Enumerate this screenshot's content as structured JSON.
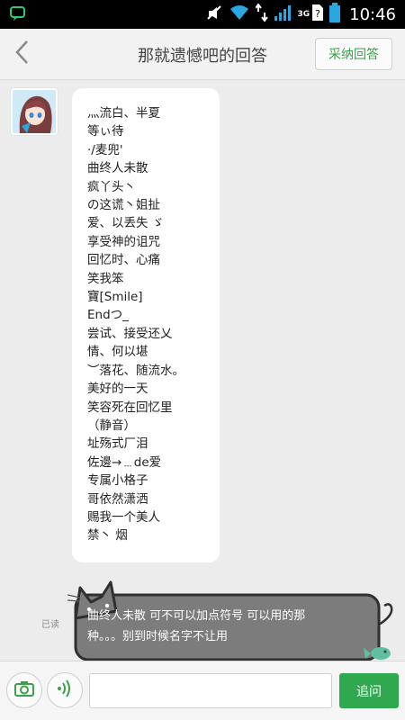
{
  "status_bar": {
    "time": "10:46",
    "network": "3G",
    "icons": [
      "chat-notification-icon",
      "mute-icon",
      "wifi-icon",
      "data-transfer-icon",
      "signal-icon",
      "battery-icon"
    ]
  },
  "navbar": {
    "title": "那就遗憾吧的回答",
    "accept_label": "采纳回答",
    "back_icon": "chevron-left-icon"
  },
  "message_left": {
    "lines": [
      "灬流白、半夏",
      "等ぃ待",
      "·/麦兜'",
      "曲终人未散",
      "疯丫头丶",
      "の这谎丶姐扯",
      "爱、以丢失 ゞ",
      "享受神的诅咒",
      "回忆时、心痛",
      "笑我笨",
      "寶[Smile]",
      "Endつ_",
      "尝试、接受还乂",
      "情、何以堪",
      "︶落花、随流水。",
      "美好的一天",
      "笑容死在回忆里",
      "（静音）",
      "址殇式厂泪",
      "佐邊→﹍de爱",
      "专属小格子",
      "哥依然潇洒",
      "赐我一个美人",
      "禁丶 烟"
    ]
  },
  "message_right": {
    "read_status": "已读",
    "line1": "曲终人未散 可不可以加点符号 可以用的那",
    "line2": "种。。。别到时候名字不让用"
  },
  "input_bar": {
    "camera_icon": "camera-icon",
    "voice_icon": "voice-icon",
    "placeholder": "",
    "send_label": "追问"
  },
  "colors": {
    "accent_green": "#2fa84f",
    "chat_bg": "#ececec",
    "cat_bubble": "#7c7c7c"
  }
}
